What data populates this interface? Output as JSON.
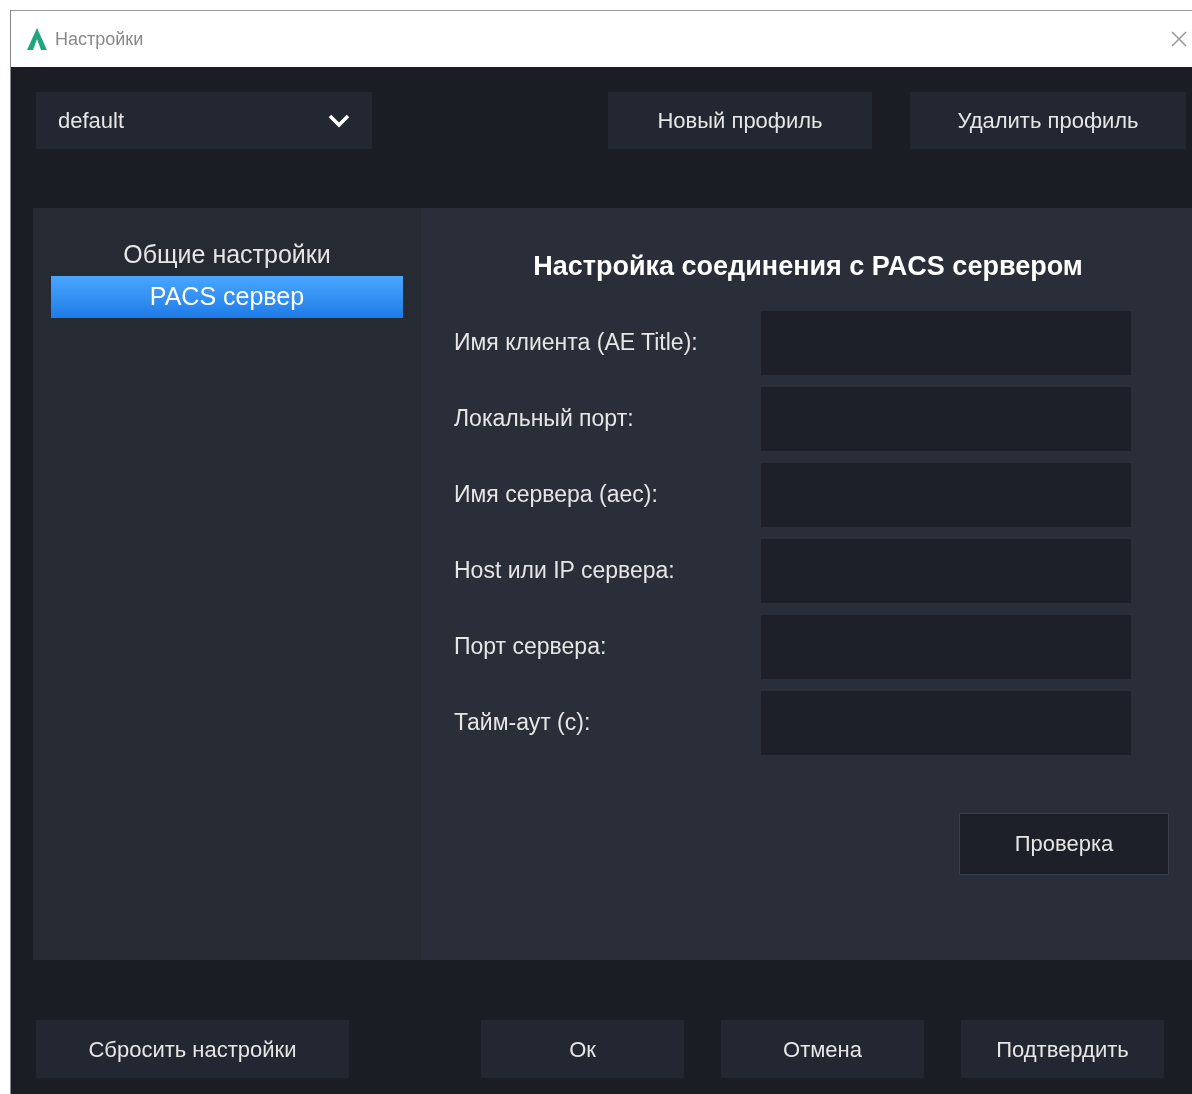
{
  "window": {
    "title": "Настройки"
  },
  "profile": {
    "value": "default",
    "buttons": [
      "Новый профиль",
      "Удалить профиль"
    ]
  },
  "sidebar": {
    "items": [
      {
        "label": "Общие настройки",
        "selected": false
      },
      {
        "label": "PACS сервер",
        "selected": true
      }
    ]
  },
  "panel": {
    "heading": "Настройка соединения с PACS сервером",
    "fields": [
      {
        "label": "Имя клиента (AE Title):"
      },
      {
        "label": "Локальный порт:"
      },
      {
        "label": "Имя сервера (aec):"
      },
      {
        "label": "Host или IP сервера:"
      },
      {
        "label": "Порт сервера:"
      },
      {
        "label": "Тайм-аут (с):"
      }
    ],
    "check_button": "Проверка"
  },
  "footer": {
    "reset": "Сбросить настройки",
    "buttons": [
      "Ок",
      "Отмена",
      "Подтвердить"
    ]
  }
}
